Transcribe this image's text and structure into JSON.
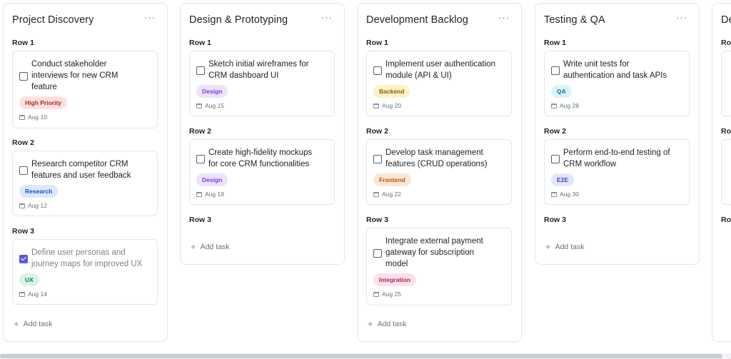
{
  "columns": [
    {
      "title": "Project Discovery",
      "more": "···",
      "rows": [
        "Row 1",
        "Row 2",
        "Row 3"
      ],
      "cards": [
        {
          "title_lines": [
            "Conduct stakeholder",
            "interviews for new CRM",
            "feature"
          ],
          "tag": "High Priority",
          "date": "Aug 10",
          "checked": false
        },
        {
          "title_lines": [
            "Research competitor CRM",
            "features and user feedback"
          ],
          "tag": "Research",
          "date": "Aug 12",
          "checked": false
        },
        {
          "title_lines": [
            "Define user personas and",
            "journey maps for improved UX"
          ],
          "tag": "UX",
          "date": "Aug 14",
          "checked": true
        }
      ],
      "add_task": "Add task"
    },
    {
      "title": "Design & Prototyping",
      "more": "···",
      "rows": [
        "Row 1",
        "Row 2",
        "Row 3"
      ],
      "cards": [
        {
          "title_lines": [
            "Sketch initial wireframes for",
            "CRM dashboard UI"
          ],
          "tag": "Design",
          "date": "Aug 15",
          "checked": false
        },
        {
          "title_lines": [
            "Create high-fidelity mockups",
            "for core CRM functionalities"
          ],
          "tag": "Design",
          "date": "Aug 18",
          "checked": false
        }
      ],
      "add_task": "Add task"
    },
    {
      "title": "Development Backlog",
      "more": "···",
      "rows": [
        "Row 1",
        "Row 2",
        "Row 3"
      ],
      "cards": [
        {
          "title_lines": [
            "Implement user authentication",
            "module (API & UI)"
          ],
          "tag": "Backend",
          "date": "Aug 20",
          "checked": false
        },
        {
          "title_lines": [
            "Develop task management",
            "features (CRUD operations)"
          ],
          "tag": "Frontend",
          "date": "Aug 22",
          "checked": false
        },
        {
          "title_lines": [
            "Integrate external payment",
            "gateway for subscription",
            "model"
          ],
          "tag": "Integration",
          "date": "Aug 25",
          "checked": false
        }
      ],
      "add_task": "Add task"
    },
    {
      "title": "Testing & QA",
      "more": "···",
      "rows": [
        "Row 1",
        "Row 2",
        "Row 3"
      ],
      "cards": [
        {
          "title_lines": [
            "Write unit tests for",
            "authentication and task APIs"
          ],
          "tag": "QA",
          "date": "Aug 28",
          "checked": false
        },
        {
          "title_lines": [
            "Perform end-to-end testing of",
            "CRM workflow"
          ],
          "tag": "E2E",
          "date": "Aug 30",
          "checked": false
        }
      ],
      "add_task": "Add task"
    },
    {
      "title": "De",
      "rows": [
        "Ro",
        "Ro",
        "Ro"
      ]
    }
  ],
  "tag_colors": {
    "High Priority": {
      "bg": "#fde0e0",
      "fg": "#b42318"
    },
    "Research": {
      "bg": "#dde8fc",
      "fg": "#1d4ed8"
    },
    "UX": {
      "bg": "#d9f5e5",
      "fg": "#16794a"
    },
    "Design": {
      "bg": "#ede3fb",
      "fg": "#7c3aed"
    },
    "Backend": {
      "bg": "#fdf1c7",
      "fg": "#8a5a00"
    },
    "Frontend": {
      "bg": "#fde6d3",
      "fg": "#b4530f"
    },
    "Integration": {
      "bg": "#fce1ec",
      "fg": "#b0275e"
    },
    "QA": {
      "bg": "#d8f4f8",
      "fg": "#0e7490"
    },
    "E2E": {
      "bg": "#e3e6fc",
      "fg": "#3f46c4"
    }
  }
}
